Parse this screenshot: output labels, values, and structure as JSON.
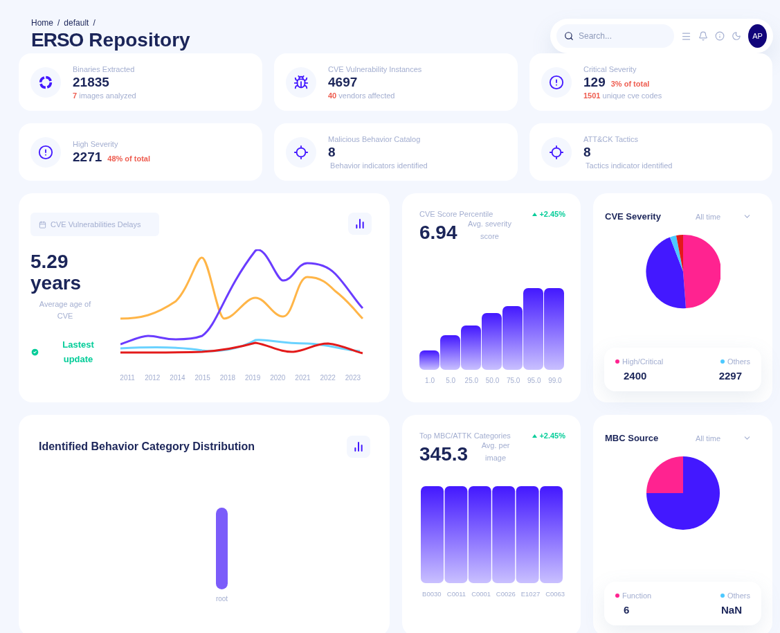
{
  "breadcrumb": [
    {
      "label": "Home",
      "separator": "/"
    },
    {
      "label": "default",
      "separator": "/"
    }
  ],
  "title": {
    "brand": "ERSO",
    "rest": "Repository"
  },
  "toolbar": {
    "search": {
      "placeholder": "Search..."
    },
    "avatar": "AP"
  },
  "stats": [
    {
      "label": "Binaries Extracted",
      "value": "21835",
      "sub_count": "7",
      "sub_text": "images analyzed"
    },
    {
      "label": "CVE Vulnerability Instances",
      "value": "4697",
      "sub_count": "40",
      "sub_text": "vendors affected"
    },
    {
      "label": "Critical Severity",
      "value": "129",
      "badge": "3% of total",
      "sub_count": "1501",
      "sub_text": "unique cve codes"
    },
    {
      "label": "High Severity",
      "value": "2271",
      "badge": "48% of total"
    },
    {
      "label": "Malicious Behavior Catalog",
      "value": "8",
      "sub_text": "Behavior indicators identified"
    },
    {
      "label": "ATT&CK Tactics",
      "value": "8",
      "sub_text": "Tactics indicator identified"
    }
  ],
  "delays": {
    "chip": "CVE Vulnerabilities Delays",
    "value": "5.29",
    "unit": "years",
    "caption": "Average age of CVE",
    "status": "Lastest update",
    "x_labels": [
      "2011",
      "2012",
      "2014",
      "2015",
      "2018",
      "2019",
      "2020",
      "2021",
      "2022",
      "2023"
    ]
  },
  "score": {
    "title": "CVE Score Percentile",
    "trend": "+2.45%",
    "value": "6.94",
    "caption": "Avg. severity score",
    "x_labels": [
      "1.0",
      "5.0",
      "25.0",
      "50.0",
      "75.0",
      "95.0",
      "99.0"
    ]
  },
  "severity": {
    "title": "CVE Severity",
    "period": "All time",
    "legend": [
      {
        "label": "High/Critical",
        "value": "2400",
        "color": "#ff2390"
      },
      {
        "label": "Others",
        "value": "2297",
        "color": "#4cc9ff"
      }
    ]
  },
  "distribution": {
    "title": "Identified Behavior Category Distribution",
    "x_labels": [
      "root"
    ]
  },
  "categories": {
    "title": "Top MBC/ATTK Categories",
    "trend": "+2.45%",
    "value": "345.3",
    "caption": "Avg. per image",
    "x_labels": [
      "B0030",
      "C0011",
      "C0001",
      "C0026",
      "E1027",
      "C0063"
    ]
  },
  "source": {
    "title": "MBC Source",
    "period": "All time",
    "legend": [
      {
        "label": "Function",
        "value": "6",
        "color": "#ff2390"
      },
      {
        "label": "Others",
        "value": "NaN",
        "color": "#4cc9ff"
      }
    ]
  }
}
